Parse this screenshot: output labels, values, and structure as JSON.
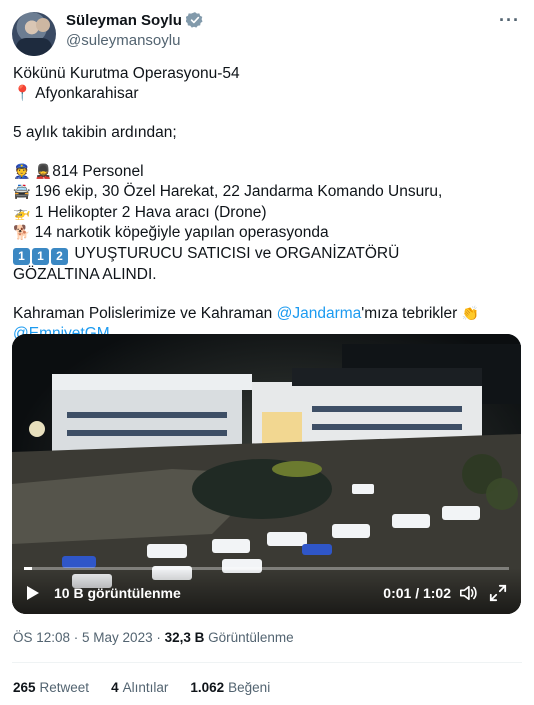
{
  "author": {
    "display_name": "Süleyman Soylu",
    "handle": "@suleymansoylu",
    "verified": true
  },
  "more_icon": "···",
  "tweet": {
    "line1": "Kökünü Kurutma Operasyonu-54",
    "location": "Afyonkarahisar",
    "line3": "5 aylık takibin ardından;",
    "personnel": "814 Personel",
    "teams": "196 ekip, 30 Özel Harekat, 22 Jandarma Komando Unsuru,",
    "aircraft": "1 Helikopter 2 Hava aracı (Drone)",
    "dogs": "14 narkotik köpeğiyle yapılan operasyonda",
    "keycaps": [
      "1",
      "1",
      "2"
    ],
    "result_a": "UYUŞTURUCU SATICISI ve ORGANİZATÖRÜ",
    "result_b": "GÖZALTINA ALINDI.",
    "thanks_pre": "Kahraman Polislerimize ve Kahraman ",
    "mention1": "@Jandarma",
    "thanks_post": "'mıza tebrikler",
    "mention2": "@EmniyetGM"
  },
  "video": {
    "views": "10 B görüntülenme",
    "time": "0:01 / 1:02",
    "progress": 0.016
  },
  "meta": {
    "time": "ÖS 12:08 · 5 May 2023 · ",
    "views_count": "32,3 B",
    "views_label": " Görüntülenme"
  },
  "stats": {
    "retweets_count": "265",
    "retweets_label": "Retweet",
    "quotes_count": "4",
    "quotes_label": "Alıntılar",
    "likes_count": "1.062",
    "likes_label": "Beğeni"
  },
  "colors": {
    "link": "#1d9bf0",
    "verified": "#829aab",
    "muted": "#536471"
  }
}
